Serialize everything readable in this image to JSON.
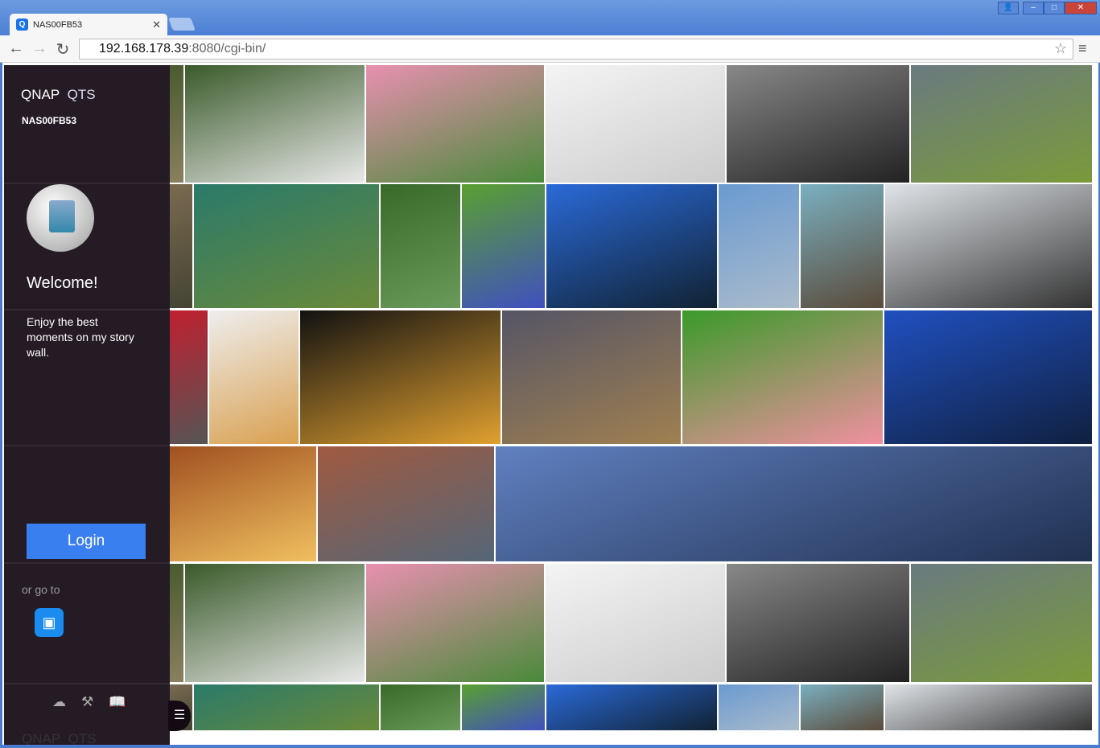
{
  "browser": {
    "tab_title": "NAS00FB53",
    "url_host": "192.168.178.39",
    "url_rest": ":8080/cgi-bin/"
  },
  "panel": {
    "brand": "QNAP",
    "product": "QTS",
    "device_name": "NAS00FB53",
    "welcome": "Welcome!",
    "tagline": "Enjoy the best moments on my story wall.",
    "login_label": "Login",
    "or_go_to": "or go to",
    "footer_brand": "QNAP",
    "footer_product": "QTS"
  }
}
